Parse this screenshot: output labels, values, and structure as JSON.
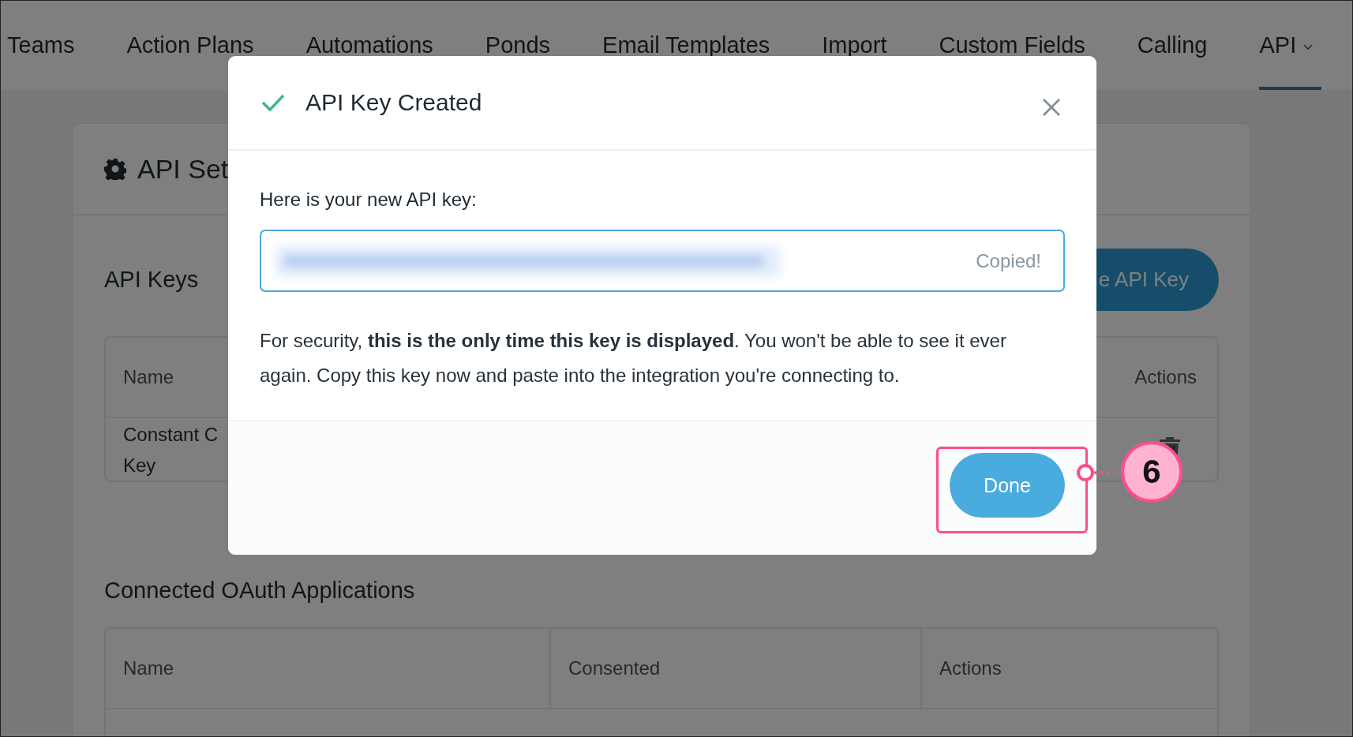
{
  "nav": {
    "tabs": [
      {
        "label": "Teams",
        "selected": false,
        "has_menu": false
      },
      {
        "label": "Action Plans",
        "selected": false,
        "has_menu": false
      },
      {
        "label": "Automations",
        "selected": false,
        "has_menu": false
      },
      {
        "label": "Ponds",
        "selected": false,
        "has_menu": false
      },
      {
        "label": "Email Templates",
        "selected": false,
        "has_menu": false
      },
      {
        "label": "Import",
        "selected": false,
        "has_menu": false
      },
      {
        "label": "Custom Fields",
        "selected": false,
        "has_menu": false
      },
      {
        "label": "Calling",
        "selected": false,
        "has_menu": false
      },
      {
        "label": "API",
        "selected": true,
        "has_menu": true
      }
    ]
  },
  "settings_card": {
    "title": "API Set",
    "section_title": "API Keys",
    "create_button": "e API Key",
    "keys_table": {
      "columns": [
        "Name",
        "Actions"
      ],
      "rows": [
        {
          "name_lines": [
            "Constant C",
            "Key"
          ]
        }
      ]
    },
    "oauth": {
      "title": "Connected OAuth Applications",
      "columns": [
        "Name",
        "Consented",
        "Actions"
      ]
    }
  },
  "modal": {
    "title": "API Key Created",
    "prompt": "Here is your new API key:",
    "key_status": "Copied!",
    "notice": "For security, **this is the only time this key is displayed**. You won't be able to see it ever again. Copy this key now and paste into the integration you're connecting to.",
    "done_button": "Done"
  },
  "callout": {
    "number": "6"
  }
}
